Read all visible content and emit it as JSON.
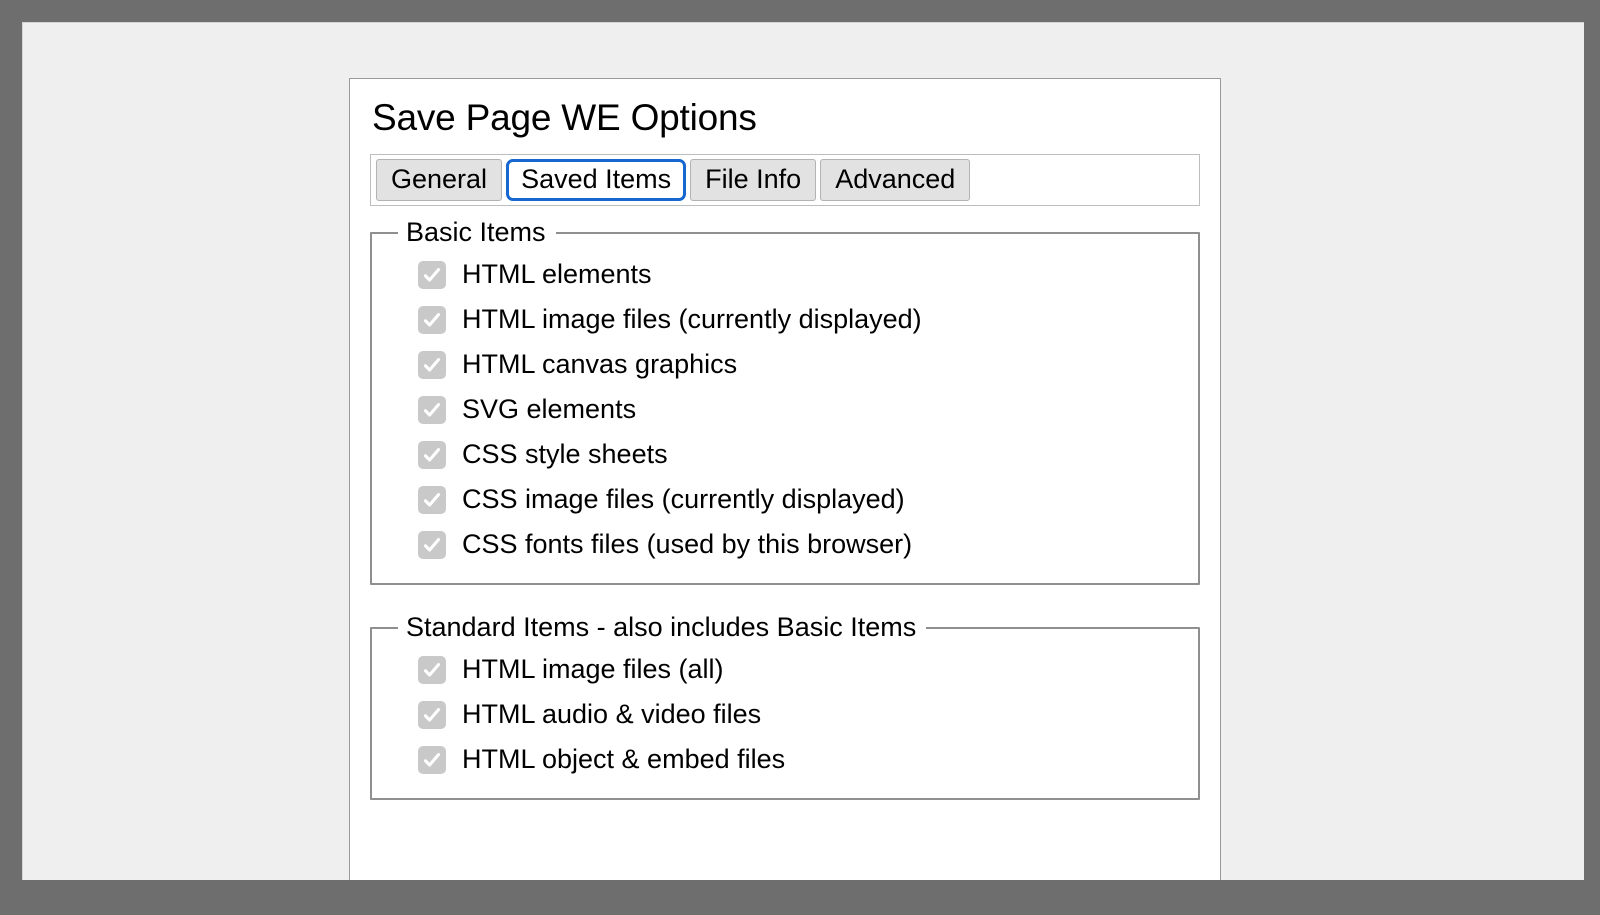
{
  "window": {
    "outer_background": "#6e6e6e",
    "page_background": "#efefef",
    "panel_background": "#ffffff"
  },
  "header": {
    "title": "Save Page WE Options"
  },
  "tabs": {
    "selected": "Saved Items",
    "accent_color": "#1668d0",
    "items": [
      {
        "label": "General",
        "selected": false
      },
      {
        "label": "Saved Items",
        "selected": true
      },
      {
        "label": "File Info",
        "selected": false
      },
      {
        "label": "Advanced",
        "selected": false
      }
    ]
  },
  "groups": [
    {
      "legend": "Basic Items",
      "items": [
        {
          "label": "HTML elements",
          "checked": true,
          "disabled": true
        },
        {
          "label": "HTML image files (currently displayed)",
          "checked": true,
          "disabled": true
        },
        {
          "label": "HTML canvas graphics",
          "checked": true,
          "disabled": true
        },
        {
          "label": "SVG elements",
          "checked": true,
          "disabled": true
        },
        {
          "label": "CSS style sheets",
          "checked": true,
          "disabled": true
        },
        {
          "label": "CSS image files (currently displayed)",
          "checked": true,
          "disabled": true
        },
        {
          "label": "CSS fonts files (used by this browser)",
          "checked": true,
          "disabled": true
        }
      ]
    },
    {
      "legend": "Standard Items - also includes Basic Items",
      "items": [
        {
          "label": "HTML image files (all)",
          "checked": true,
          "disabled": true
        },
        {
          "label": "HTML audio & video files",
          "checked": true,
          "disabled": true
        },
        {
          "label": "HTML object & embed files",
          "checked": true,
          "disabled": true
        }
      ]
    }
  ],
  "icons": {
    "checkmark": "check-icon"
  }
}
